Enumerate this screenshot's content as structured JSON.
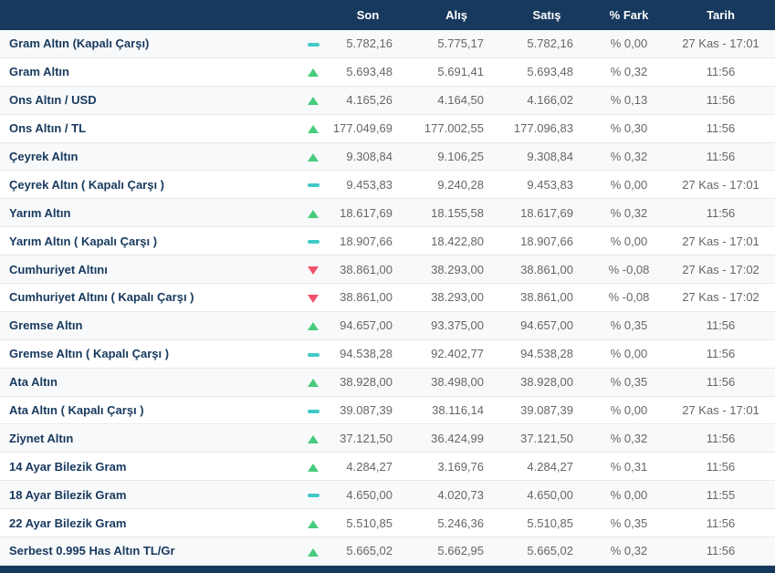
{
  "colors": {
    "header_bg": "#17395E",
    "instrument_text": "#17395E",
    "value_text": "#666666",
    "up_arrow": "#47CC7E",
    "down_arrow": "#F4516C",
    "flat_dash": "#41C9C8"
  },
  "table": {
    "headers": {
      "son": "Son",
      "alis": "Alış",
      "satis": "Satış",
      "fark": "% Fark",
      "tarih": "Tarih"
    },
    "rows": [
      {
        "name": "Gram Altın (Kapalı Çarşı)",
        "trend": "flat",
        "son": "5.782,16",
        "alis": "5.775,17",
        "satis": "5.782,16",
        "fark": "% 0,00",
        "tarih": "27 Kas - 17:01"
      },
      {
        "name": "Gram Altın",
        "trend": "up",
        "son": "5.693,48",
        "alis": "5.691,41",
        "satis": "5.693,48",
        "fark": "% 0,32",
        "tarih": "11:56"
      },
      {
        "name": "Ons Altın / USD",
        "trend": "up",
        "son": "4.165,26",
        "alis": "4.164,50",
        "satis": "4.166,02",
        "fark": "% 0,13",
        "tarih": "11:56"
      },
      {
        "name": "Ons Altın / TL",
        "trend": "up",
        "son": "177.049,69",
        "alis": "177.002,55",
        "satis": "177.096,83",
        "fark": "% 0,30",
        "tarih": "11:56"
      },
      {
        "name": "Çeyrek Altın",
        "trend": "up",
        "son": "9.308,84",
        "alis": "9.106,25",
        "satis": "9.308,84",
        "fark": "% 0,32",
        "tarih": "11:56"
      },
      {
        "name": "Çeyrek Altın ( Kapalı Çarşı )",
        "trend": "flat",
        "son": "9.453,83",
        "alis": "9.240,28",
        "satis": "9.453,83",
        "fark": "% 0,00",
        "tarih": "27 Kas - 17:01"
      },
      {
        "name": "Yarım Altın",
        "trend": "up",
        "son": "18.617,69",
        "alis": "18.155,58",
        "satis": "18.617,69",
        "fark": "% 0,32",
        "tarih": "11:56"
      },
      {
        "name": "Yarım Altın ( Kapalı Çarşı )",
        "trend": "flat",
        "son": "18.907,66",
        "alis": "18.422,80",
        "satis": "18.907,66",
        "fark": "% 0,00",
        "tarih": "27 Kas - 17:01"
      },
      {
        "name": "Cumhuriyet Altını",
        "trend": "down",
        "son": "38.861,00",
        "alis": "38.293,00",
        "satis": "38.861,00",
        "fark": "% -0,08",
        "tarih": "27 Kas - 17:02"
      },
      {
        "name": "Cumhuriyet Altını ( Kapalı Çarşı )",
        "trend": "down",
        "son": "38.861,00",
        "alis": "38.293,00",
        "satis": "38.861,00",
        "fark": "% -0,08",
        "tarih": "27 Kas - 17:02"
      },
      {
        "name": "Gremse Altın",
        "trend": "up",
        "son": "94.657,00",
        "alis": "93.375,00",
        "satis": "94.657,00",
        "fark": "% 0,35",
        "tarih": "11:56"
      },
      {
        "name": "Gremse Altın ( Kapalı Çarşı )",
        "trend": "flat",
        "son": "94.538,28",
        "alis": "92.402,77",
        "satis": "94.538,28",
        "fark": "% 0,00",
        "tarih": "11:56"
      },
      {
        "name": "Ata Altın",
        "trend": "up",
        "son": "38.928,00",
        "alis": "38.498,00",
        "satis": "38.928,00",
        "fark": "% 0,35",
        "tarih": "11:56"
      },
      {
        "name": "Ata Altın ( Kapalı Çarşı )",
        "trend": "flat",
        "son": "39.087,39",
        "alis": "38.116,14",
        "satis": "39.087,39",
        "fark": "% 0,00",
        "tarih": "27 Kas - 17:01"
      },
      {
        "name": "Ziynet Altın",
        "trend": "up",
        "son": "37.121,50",
        "alis": "36.424,99",
        "satis": "37.121,50",
        "fark": "% 0,32",
        "tarih": "11:56"
      },
      {
        "name": "14 Ayar Bilezik Gram",
        "trend": "up",
        "son": "4.284,27",
        "alis": "3.169,76",
        "satis": "4.284,27",
        "fark": "% 0,31",
        "tarih": "11:56"
      },
      {
        "name": "18 Ayar Bilezik Gram",
        "trend": "flat",
        "son": "4.650,00",
        "alis": "4.020,73",
        "satis": "4.650,00",
        "fark": "% 0,00",
        "tarih": "11:55"
      },
      {
        "name": "22 Ayar Bilezik Gram",
        "trend": "up",
        "son": "5.510,85",
        "alis": "5.246,36",
        "satis": "5.510,85",
        "fark": "% 0,35",
        "tarih": "11:56"
      },
      {
        "name": "Serbest 0.995 Has Altın TL/Gr",
        "trend": "up",
        "son": "5.665,02",
        "alis": "5.662,95",
        "satis": "5.665,02",
        "fark": "% 0,32",
        "tarih": "11:56"
      }
    ]
  }
}
